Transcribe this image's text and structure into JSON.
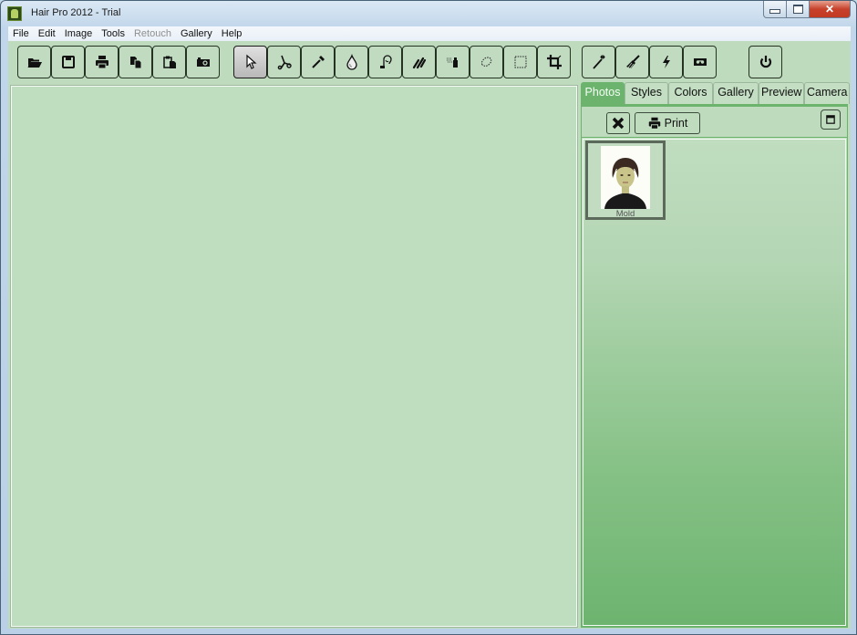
{
  "window": {
    "title": "Hair Pro 2012 - Trial",
    "controls": [
      "minimize",
      "maximize",
      "close"
    ]
  },
  "menubar": {
    "items": [
      {
        "label": "File",
        "enabled": true
      },
      {
        "label": "Edit",
        "enabled": true
      },
      {
        "label": "Image",
        "enabled": true
      },
      {
        "label": "Tools",
        "enabled": true
      },
      {
        "label": "Retouch",
        "enabled": false
      },
      {
        "label": "Gallery",
        "enabled": true
      },
      {
        "label": "Help",
        "enabled": true
      }
    ]
  },
  "toolbar": {
    "buttons": [
      {
        "icon": "open-folder-icon",
        "tooltip": "Open"
      },
      {
        "icon": "save-icon",
        "tooltip": "Save"
      },
      {
        "icon": "print-icon",
        "tooltip": "Print"
      },
      {
        "icon": "copy-icon",
        "tooltip": "Copy"
      },
      {
        "icon": "paste-icon",
        "tooltip": "Paste"
      },
      {
        "icon": "camera-icon",
        "tooltip": "Camera"
      },
      {
        "icon": "pointer-icon",
        "tooltip": "Select",
        "active": true
      },
      {
        "icon": "scissors-icon",
        "tooltip": "Cut"
      },
      {
        "icon": "eyedropper-icon",
        "tooltip": "Eyedropper"
      },
      {
        "icon": "drop-icon",
        "tooltip": "Drop"
      },
      {
        "icon": "hair-icon",
        "tooltip": "Hair"
      },
      {
        "icon": "brush-strokes-icon",
        "tooltip": "Strokes"
      },
      {
        "icon": "spray-icon",
        "tooltip": "Spray"
      },
      {
        "icon": "lasso-icon",
        "tooltip": "Lasso"
      },
      {
        "icon": "rect-select-icon",
        "tooltip": "Rectangle select"
      },
      {
        "icon": "crop-icon",
        "tooltip": "Crop"
      },
      {
        "icon": "magic-wand-icon",
        "tooltip": "Magic wand"
      },
      {
        "icon": "paint-brush-icon",
        "tooltip": "Brush"
      },
      {
        "icon": "lightning-icon",
        "tooltip": "Flash"
      },
      {
        "icon": "tape-icon",
        "tooltip": "Record"
      },
      {
        "icon": "power-icon",
        "tooltip": "Exit"
      }
    ]
  },
  "panel": {
    "tabs": [
      {
        "label": "Photos",
        "active": true
      },
      {
        "label": "Styles",
        "active": false
      },
      {
        "label": "Colors",
        "active": false
      },
      {
        "label": "Gallery",
        "active": false
      },
      {
        "label": "Preview",
        "active": false
      },
      {
        "label": "Camera",
        "active": false
      }
    ],
    "delete_icon": "x-icon",
    "print_label": "Print",
    "thumbnails": [
      {
        "label": "Mold"
      }
    ]
  },
  "colors": {
    "canvas_bg": "#bfddbf",
    "active_tab": "#6cb46e",
    "panel_gradient_bottom": "#6db46f"
  }
}
